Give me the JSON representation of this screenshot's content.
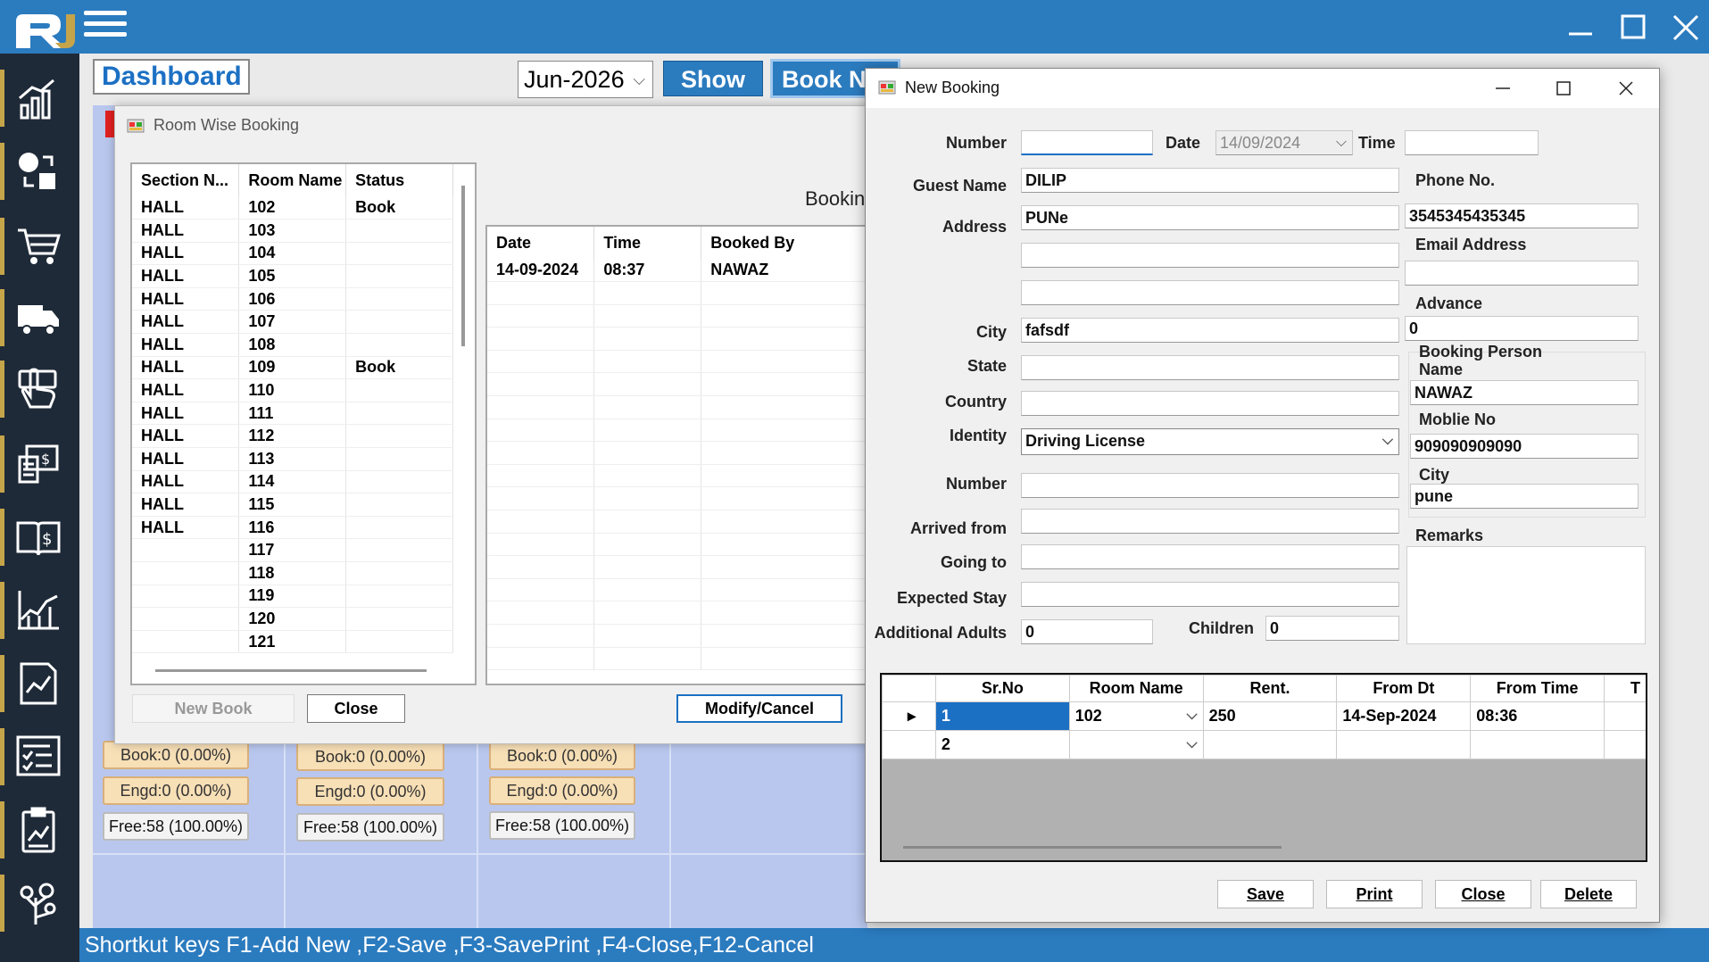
{
  "window_controls": {
    "minimize": "minimize-icon",
    "maximize": "maximize-icon",
    "close": "close-icon"
  },
  "dashboard": {
    "title": "Dashboard",
    "month": "Jun-2026",
    "show_label": "Show",
    "book_new_label": "Book Ne",
    "stats": [
      {
        "book": "Book:0 (0.00%)",
        "engd": "Engd:0 (0.00%)",
        "free": "Free:58 (100.00%)"
      },
      {
        "book": "Book:0 (0.00%)",
        "engd": "Engd:0 (0.00%)",
        "free": "Free:58 (100.00%)"
      },
      {
        "book": "Book:0 (0.00%)",
        "engd": "Engd:0 (0.00%)",
        "free": "Free:58 (100.00%)"
      }
    ]
  },
  "sidebar": {
    "items": [
      "analytics-icon",
      "exchange-icon",
      "cart-icon",
      "truck-icon",
      "hand-cursor-icon",
      "money-report-icon",
      "ledger-icon",
      "stock-chart-icon",
      "line-chart-doc-icon",
      "checklist-icon",
      "clipboard-chart-icon",
      "settings-tree-icon"
    ]
  },
  "status_bar": "Shortkut keys F1-Add New ,F2-Save ,F3-SavePrint ,F4-Close,F12-Cancel",
  "room_wise": {
    "title": "Room Wise Booking",
    "columns": [
      "Section N...",
      "Room Name",
      "Status"
    ],
    "rows": [
      [
        "HALL",
        "102",
        "Book"
      ],
      [
        "HALL",
        "103",
        ""
      ],
      [
        "HALL",
        "104",
        ""
      ],
      [
        "HALL",
        "105",
        ""
      ],
      [
        "HALL",
        "106",
        ""
      ],
      [
        "HALL",
        "107",
        ""
      ],
      [
        "HALL",
        "108",
        ""
      ],
      [
        "HALL",
        "109",
        "Book"
      ],
      [
        "HALL",
        "110",
        ""
      ],
      [
        "HALL",
        "111",
        ""
      ],
      [
        "HALL",
        "112",
        ""
      ],
      [
        "HALL",
        "113",
        ""
      ],
      [
        "HALL",
        "114",
        ""
      ],
      [
        "HALL",
        "115",
        ""
      ],
      [
        "HALL",
        "116",
        ""
      ],
      [
        "",
        "117",
        ""
      ],
      [
        "",
        "118",
        ""
      ],
      [
        "",
        "119",
        ""
      ],
      [
        "",
        "120",
        ""
      ],
      [
        "",
        "121",
        ""
      ]
    ],
    "booking_label": "Bookin",
    "history_columns": [
      "Date",
      "Time",
      "Booked By"
    ],
    "history_rows": [
      [
        "14-09-2024",
        "08:37",
        "NAWAZ"
      ]
    ],
    "new_book": "New Book",
    "close": "Close",
    "modify": "Modify/Cancel"
  },
  "new_booking": {
    "title": "New Booking",
    "labels": {
      "number": "Number",
      "date": "Date",
      "time": "Time",
      "guest_name": "Guest Name",
      "phone": "Phone No.",
      "address": "Address",
      "email": "Email Address",
      "advance": "Advance",
      "city": "City",
      "state": "State",
      "country": "Country",
      "identity": "Identity",
      "id_number": "Number",
      "arrived_from": "Arrived from",
      "going_to": "Going to",
      "expected_stay": "Expected Stay",
      "additional_adults": "Additional Adults",
      "children": "Children",
      "bp_name": "Booking Person Name",
      "mobile": "Moblie No",
      "bp_city": "City",
      "remarks": "Remarks"
    },
    "values": {
      "number": "",
      "date": "14/09/2024",
      "time": "",
      "guest_name": "DILIP",
      "phone": "3545345435345",
      "address1": "PUNe",
      "address2": "",
      "address3": "",
      "email": "",
      "advance": "0",
      "city": "fafsdf",
      "state": "",
      "country": "",
      "identity": "Driving License",
      "id_number": "",
      "arrived_from": "",
      "going_to": "",
      "expected_stay": "",
      "additional_adults": "0",
      "children": "0",
      "bp_name": "NAWAZ",
      "mobile": "909090909090",
      "bp_city": "pune"
    },
    "grid_columns": [
      "",
      "Sr.No",
      "Room Name",
      "Rent.",
      "From Dt",
      "From Time",
      "T"
    ],
    "grid_rows": [
      [
        "1",
        "102",
        "250",
        "14-Sep-2024",
        "08:36"
      ],
      [
        "2",
        "",
        "",
        "",
        ""
      ]
    ],
    "buttons": {
      "save": "Save",
      "print": "Print",
      "close": "Close",
      "delete": "Delete"
    }
  }
}
